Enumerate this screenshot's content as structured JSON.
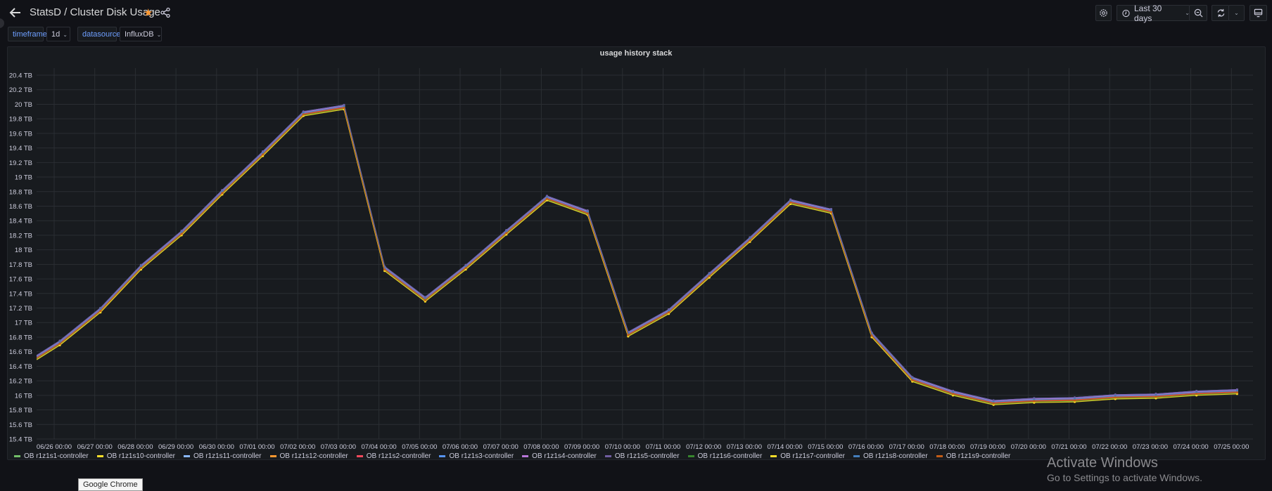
{
  "header": {
    "title": "StatsD  / Cluster Disk Usage",
    "time_range": "Last 30 days"
  },
  "variables": [
    {
      "label": "timeframe",
      "value": "1d"
    },
    {
      "label": "datasource",
      "value": "InfluxDB"
    }
  ],
  "panel": {
    "title": "usage history stack"
  },
  "overlay": {
    "activate_title": "Activate Windows",
    "activate_sub": "Go to Settings to activate Windows.",
    "tooltip": "Google Chrome"
  },
  "chart_data": {
    "type": "line",
    "title": "usage history stack",
    "xlabel": "",
    "ylabel": "",
    "x_unit": "days since 06/26 00:00",
    "xlim": [
      -0.43,
      29.55
    ],
    "ylim": [
      15.4,
      20.5
    ],
    "grid": true,
    "legend_placement": "bottom-left",
    "y_ticks": [
      "15.4 TB",
      "15.6 TB",
      "15.8 TB",
      "16 TB",
      "16.2 TB",
      "16.4 TB",
      "16.6 TB",
      "16.8 TB",
      "17 TB",
      "17.2 TB",
      "17.4 TB",
      "17.6 TB",
      "17.8 TB",
      "18 TB",
      "18.2 TB",
      "18.4 TB",
      "18.6 TB",
      "18.8 TB",
      "19 TB",
      "19.2 TB",
      "19.4 TB",
      "19.6 TB",
      "19.8 TB",
      "20 TB",
      "20.2 TB",
      "20.4 TB"
    ],
    "y_tick_values": [
      15.4,
      15.6,
      15.8,
      16.0,
      16.2,
      16.4,
      16.6,
      16.8,
      17.0,
      17.2,
      17.4,
      17.6,
      17.8,
      18.0,
      18.2,
      18.4,
      18.6,
      18.8,
      19.0,
      19.2,
      19.4,
      19.6,
      19.8,
      20.0,
      20.2,
      20.4
    ],
    "x_ticks": [
      "06/26 00:00",
      "06/27 00:00",
      "06/28 00:00",
      "06/29 00:00",
      "06/30 00:00",
      "07/01 00:00",
      "07/02 00:00",
      "07/03 00:00",
      "07/04 00:00",
      "07/05 00:00",
      "07/06 00:00",
      "07/07 00:00",
      "07/08 00:00",
      "07/09 00:00",
      "07/10 00:00",
      "07/11 00:00",
      "07/12 00:00",
      "07/13 00:00",
      "07/14 00:00",
      "07/15 00:00",
      "07/16 00:00",
      "07/17 00:00",
      "07/18 00:00",
      "07/19 00:00",
      "07/20 00:00",
      "07/21 00:00",
      "07/22 00:00",
      "07/23 00:00",
      "07/24 00:00",
      "07/25 00:00"
    ],
    "x": [
      -0.43,
      0.14,
      1.14,
      2.14,
      3.14,
      4.14,
      5.14,
      6.14,
      7.14,
      8.14,
      9.14,
      10.14,
      11.14,
      12.14,
      13.14,
      14.14,
      15.14,
      16.14,
      17.14,
      18.14,
      19.14,
      20.14,
      21.14,
      22.14,
      23.14,
      24.14,
      25.14,
      26.14,
      27.14,
      28.14,
      29.14
    ],
    "series": [
      {
        "name": "OB r1z1s1-controller",
        "color": "#73bf69",
        "values": [
          16.53,
          16.73,
          17.18,
          17.77,
          18.24,
          18.8,
          19.33,
          19.88,
          19.97,
          17.75,
          17.33,
          17.77,
          18.25,
          18.72,
          18.52,
          16.85,
          17.16,
          17.66,
          18.15,
          18.67,
          18.54,
          16.84,
          16.23,
          16.04,
          15.91,
          15.94,
          15.95,
          15.99,
          16.0,
          16.04,
          16.06
        ]
      },
      {
        "name": "OB r1z1s10-controller",
        "color": "#fade2a",
        "values": [
          16.5,
          16.7,
          17.15,
          17.74,
          18.21,
          18.77,
          19.3,
          19.85,
          19.94,
          17.72,
          17.3,
          17.74,
          18.22,
          18.69,
          18.49,
          16.82,
          17.13,
          17.63,
          18.12,
          18.64,
          18.51,
          16.81,
          16.2,
          16.01,
          15.88,
          15.91,
          15.92,
          15.96,
          15.97,
          16.01,
          16.03
        ]
      },
      {
        "name": "OB r1z1s11-controller",
        "color": "#8ab8ff",
        "values": [
          16.54,
          16.74,
          17.19,
          17.78,
          18.25,
          18.81,
          19.34,
          19.89,
          19.98,
          17.76,
          17.34,
          17.78,
          18.26,
          18.73,
          18.53,
          16.86,
          17.17,
          17.67,
          18.16,
          18.68,
          18.55,
          16.85,
          16.24,
          16.05,
          15.92,
          15.95,
          15.96,
          16.0,
          16.01,
          16.05,
          16.07
        ]
      },
      {
        "name": "OB r1z1s12-controller",
        "color": "#ff9830",
        "values": [
          16.51,
          16.71,
          17.16,
          17.75,
          18.22,
          18.78,
          19.31,
          19.86,
          19.95,
          17.73,
          17.31,
          17.75,
          18.23,
          18.7,
          18.5,
          16.83,
          17.14,
          17.64,
          18.13,
          18.65,
          18.52,
          16.82,
          16.21,
          16.02,
          15.89,
          15.92,
          15.93,
          15.97,
          15.98,
          16.02,
          16.04
        ]
      },
      {
        "name": "OB r1z1s2-controller",
        "color": "#f2495c",
        "values": [
          16.52,
          16.72,
          17.17,
          17.76,
          18.23,
          18.79,
          19.32,
          19.87,
          19.96,
          17.74,
          17.32,
          17.76,
          18.24,
          18.71,
          18.51,
          16.84,
          17.15,
          17.65,
          18.14,
          18.66,
          18.53,
          16.83,
          16.22,
          16.03,
          15.9,
          15.93,
          15.94,
          15.98,
          15.99,
          16.03,
          16.05
        ]
      },
      {
        "name": "OB r1z1s3-controller",
        "color": "#5794f2",
        "values": [
          16.55,
          16.75,
          17.2,
          17.79,
          18.26,
          18.82,
          19.35,
          19.9,
          19.99,
          17.77,
          17.35,
          17.79,
          18.27,
          18.74,
          18.54,
          16.87,
          17.18,
          17.68,
          18.17,
          18.69,
          18.56,
          16.86,
          16.25,
          16.06,
          15.93,
          15.96,
          15.97,
          16.01,
          16.02,
          16.06,
          16.08
        ]
      },
      {
        "name": "OB r1z1s4-controller",
        "color": "#b877d9",
        "values": [
          16.54,
          16.74,
          17.19,
          17.78,
          18.25,
          18.81,
          19.34,
          19.89,
          19.98,
          17.76,
          17.34,
          17.78,
          18.26,
          18.73,
          18.53,
          16.86,
          17.17,
          17.67,
          18.16,
          18.68,
          18.55,
          16.85,
          16.24,
          16.05,
          15.92,
          15.95,
          15.96,
          16.0,
          16.01,
          16.05,
          16.07
        ]
      },
      {
        "name": "OB r1z1s5-controller",
        "color": "#705da0",
        "values": [
          16.55,
          16.75,
          17.2,
          17.79,
          18.26,
          18.82,
          19.35,
          19.9,
          19.99,
          17.77,
          17.35,
          17.79,
          18.27,
          18.74,
          18.54,
          16.87,
          17.18,
          17.68,
          18.17,
          18.69,
          18.56,
          16.86,
          16.25,
          16.06,
          15.93,
          15.96,
          15.97,
          16.01,
          16.02,
          16.06,
          16.08
        ]
      },
      {
        "name": "OB r1z1s6-controller",
        "color": "#37872d",
        "values": [
          16.5,
          16.7,
          17.15,
          17.74,
          18.21,
          18.77,
          19.3,
          19.85,
          19.94,
          17.72,
          17.3,
          17.74,
          18.22,
          18.69,
          18.49,
          16.82,
          17.13,
          17.63,
          18.12,
          18.64,
          18.51,
          16.81,
          16.2,
          16.01,
          15.88,
          15.91,
          15.92,
          15.96,
          15.97,
          16.01,
          16.03
        ]
      },
      {
        "name": "OB r1z1s7-controller",
        "color": "#fade2a",
        "values": [
          16.49,
          16.69,
          17.14,
          17.73,
          18.2,
          18.76,
          19.29,
          19.84,
          19.93,
          17.71,
          17.29,
          17.73,
          18.21,
          18.68,
          18.48,
          16.81,
          17.12,
          17.62,
          18.11,
          18.63,
          18.5,
          16.8,
          16.19,
          16.0,
          15.87,
          15.9,
          15.91,
          15.95,
          15.96,
          16.0,
          16.02
        ]
      },
      {
        "name": "OB r1z1s8-controller",
        "color": "#447ebc",
        "values": [
          16.53,
          16.73,
          17.18,
          17.77,
          18.24,
          18.8,
          19.33,
          19.88,
          19.97,
          17.75,
          17.33,
          17.77,
          18.25,
          18.72,
          18.52,
          16.85,
          17.16,
          17.66,
          18.15,
          18.67,
          18.54,
          16.84,
          16.23,
          16.04,
          15.91,
          15.94,
          15.95,
          15.99,
          16.0,
          16.04,
          16.06
        ]
      },
      {
        "name": "OB r1z1s9-controller",
        "color": "#c15c17",
        "values": [
          16.51,
          16.71,
          17.16,
          17.75,
          18.22,
          18.78,
          19.31,
          19.86,
          19.95,
          17.73,
          17.31,
          17.75,
          18.23,
          18.7,
          18.5,
          16.83,
          17.14,
          17.64,
          18.13,
          18.65,
          18.52,
          16.82,
          16.21,
          16.02,
          15.89,
          15.92,
          15.93,
          15.97,
          15.98,
          16.02,
          16.04
        ]
      }
    ]
  }
}
